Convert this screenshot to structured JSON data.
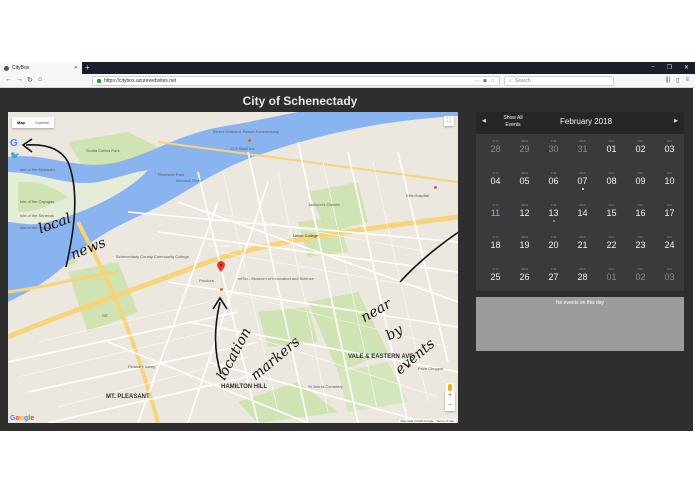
{
  "browser": {
    "tab_title": "CityBox",
    "tab_close": "✕",
    "new_tab": "+",
    "url": "https://citybox.azurewebsites.net",
    "search_placeholder": "Search",
    "back": "←",
    "forward": "→",
    "reload": "↻",
    "home": "⌂",
    "more": "···",
    "window_controls": [
      "–",
      "❐",
      "✕"
    ],
    "toolbar_icons": [
      "|||",
      "▯",
      "≡"
    ]
  },
  "page": {
    "title": "City of Schenectady"
  },
  "map": {
    "map_type_selected": "Map",
    "map_type_other": "Satellite",
    "fullscreen": "⛶",
    "zoom_in": "+",
    "zoom_out": "−",
    "google_letters": [
      "G",
      "o",
      "o",
      "g",
      "l",
      "e"
    ],
    "google_icon": "G",
    "twitter_icon": "🐦",
    "footer": [
      "Map data ©2018 Google",
      "Terms of Use"
    ],
    "labels": {
      "isle_mohawks": "Isle of the Mohawks",
      "isle_cayugas": "Isle of the Cayugas",
      "isle_senecas": "Isle of the Senecas",
      "isle_oneidas": "Isle of the Oneidas",
      "scotia": "Scotia Collins Park",
      "rivers_casino": "Rivers Casino & Resort Schenectady",
      "sts_steel": "STS Steel Inc",
      "jackson_garden": "Jackson's Garden",
      "union_college": "Union College",
      "ellis": "Ellis Hospital",
      "sccc": "Schenectady County Community College",
      "schenectady": "Schenectady",
      "proctors": "Proctors",
      "mise": "miSci - Museum of Innovation and Science",
      "vale": "VALE & EASTERN AVE",
      "hamilton": "HAMILTON HILL",
      "mt_pleasant": "MT. PLEASANT",
      "pleasant_valley": "Pleasant Valley",
      "st_johns": "St John's Cemetery",
      "price_chopper": "Price Chopper",
      "ge": "GE",
      "mohawk_river": "Mohawk River",
      "riverside": "Riverside Park"
    },
    "annotations": {
      "local": "local",
      "news": "news",
      "location": "location",
      "markers": "markers",
      "near": "near",
      "by": "by",
      "events": "events"
    }
  },
  "calendar": {
    "prev": "◀",
    "next": "▶",
    "show_all": "Show All Events",
    "month": "February 2018",
    "weeks": [
      [
        {
          "dow": "SUN",
          "num": "28",
          "muted": true
        },
        {
          "dow": "MON",
          "num": "29",
          "muted": true
        },
        {
          "dow": "TUE",
          "num": "30",
          "muted": true
        },
        {
          "dow": "WED",
          "num": "31",
          "muted": true
        },
        {
          "dow": "THU",
          "num": "01"
        },
        {
          "dow": "FRI",
          "num": "02"
        },
        {
          "dow": "SAT",
          "num": "03"
        }
      ],
      [
        {
          "dow": "SUN",
          "num": "04"
        },
        {
          "dow": "MON",
          "num": "05"
        },
        {
          "dow": "TUE",
          "num": "06"
        },
        {
          "dow": "WED",
          "num": "07",
          "dot": "white"
        },
        {
          "dow": "THU",
          "num": "08"
        },
        {
          "dow": "FRI",
          "num": "09"
        },
        {
          "dow": "SAT",
          "num": "10"
        }
      ],
      [
        {
          "dow": "SUN",
          "num": "11",
          "today": true
        },
        {
          "dow": "MON",
          "num": "12"
        },
        {
          "dow": "TUE",
          "num": "13",
          "dot": "teal"
        },
        {
          "dow": "WED",
          "num": "14"
        },
        {
          "dow": "THU",
          "num": "15"
        },
        {
          "dow": "FRI",
          "num": "16"
        },
        {
          "dow": "SAT",
          "num": "17"
        }
      ],
      [
        {
          "dow": "SUN",
          "num": "18"
        },
        {
          "dow": "MON",
          "num": "19"
        },
        {
          "dow": "TUE",
          "num": "20"
        },
        {
          "dow": "WED",
          "num": "21"
        },
        {
          "dow": "THU",
          "num": "22"
        },
        {
          "dow": "FRI",
          "num": "23"
        },
        {
          "dow": "SAT",
          "num": "24"
        }
      ],
      [
        {
          "dow": "SUN",
          "num": "25"
        },
        {
          "dow": "MON",
          "num": "26"
        },
        {
          "dow": "TUE",
          "num": "27"
        },
        {
          "dow": "WED",
          "num": "28"
        },
        {
          "dow": "THU",
          "num": "01",
          "muted": true
        },
        {
          "dow": "FRI",
          "num": "02",
          "muted": true
        },
        {
          "dow": "SAT",
          "num": "03",
          "muted": true
        }
      ]
    ],
    "no_events": "No events on this day"
  },
  "colors": {
    "page_bg": "#2e2e2e",
    "calendar_bg": "#3a3a3a",
    "event_dot": "#39c5a5",
    "marker": "#e53935"
  }
}
